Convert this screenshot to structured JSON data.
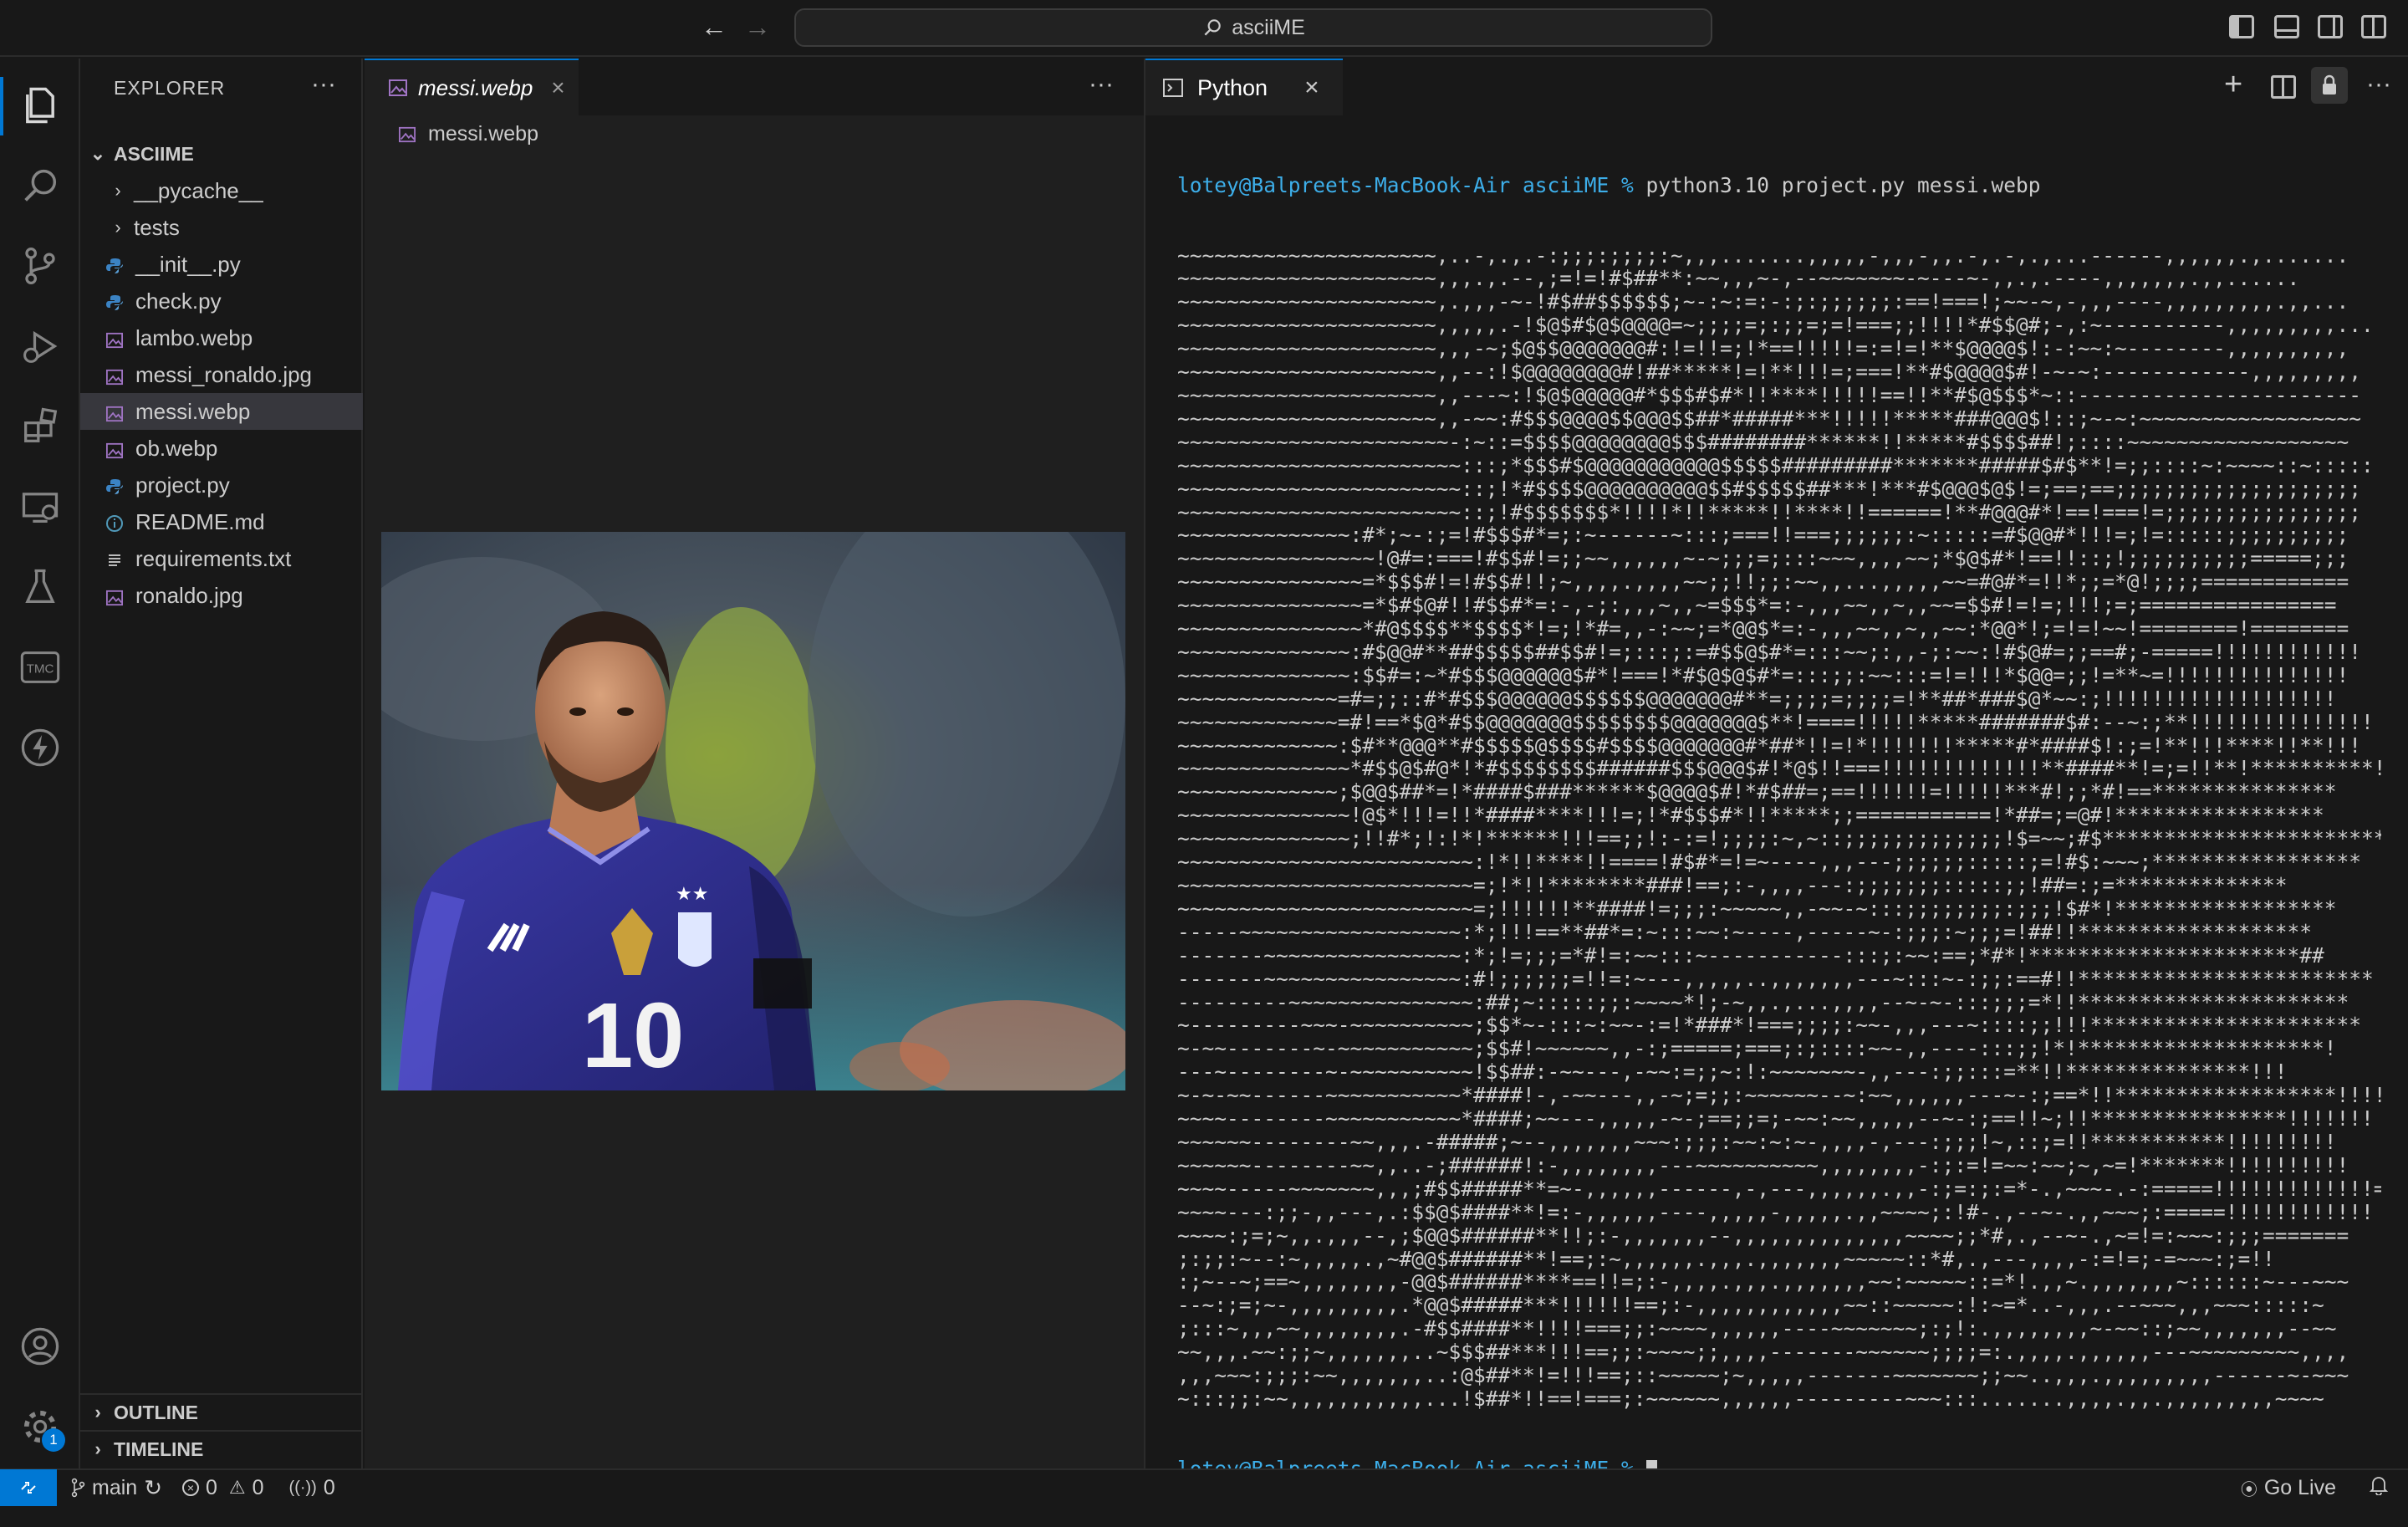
{
  "window": {
    "search_text": "asciiME"
  },
  "colors": {
    "accent": "#0078d4",
    "prompt": "#3daee9",
    "selection": "#37373d",
    "background": "#181818"
  },
  "sidebar": {
    "title": "EXPLORER",
    "more": "···",
    "root": "ASCIIME",
    "items": [
      {
        "label": "__pycache__",
        "kind": "folder"
      },
      {
        "label": "tests",
        "kind": "folder"
      },
      {
        "label": "__init__.py",
        "kind": "python"
      },
      {
        "label": "check.py",
        "kind": "python"
      },
      {
        "label": "lambo.webp",
        "kind": "image"
      },
      {
        "label": "messi_ronaldo.jpg",
        "kind": "image"
      },
      {
        "label": "messi.webp",
        "kind": "image",
        "selected": true
      },
      {
        "label": "ob.webp",
        "kind": "image"
      },
      {
        "label": "project.py",
        "kind": "python"
      },
      {
        "label": "README.md",
        "kind": "info"
      },
      {
        "label": "requirements.txt",
        "kind": "text"
      },
      {
        "label": "ronaldo.jpg",
        "kind": "image"
      }
    ],
    "outline": "OUTLINE",
    "timeline": "TIMELINE"
  },
  "editor": {
    "tab_label": "messi.webp",
    "breadcrumb": "messi.webp",
    "more": "···",
    "jersey_number": "10"
  },
  "terminal": {
    "tab_label": "Python",
    "prompt": "lotey@Balpreets-MacBook-Air asciiME % ",
    "command": "python3.10 project.py messi.webp",
    "ascii_lines": [
      "~~~~~~~~~~~~~~~~~~~~~,..-,.,.-:;;;:;;;;:~,,,.......,,,,,-,,,-,,.-,.-,.,...------,,,,,,.,.......",
      "~~~~~~~~~~~~~~~~~~~~~,,,.,.--,;=!=!#$##**:~~,,,~-,--~~~~~~~-~---~-,,.,.----,,,,,,,.,,......",
      "~~~~~~~~~~~~~~~~~~~~~,.,,,-~-!#$##$$$$$$;~-:~:=:-:;:;;;;;;:==!===!;~~-~,-,,,----,,,,,,,,,.,,...",
      "~~~~~~~~~~~~~~~~~~~~~,,,,,.-!$@$#$@$@@@@=~;;;;=;:;;=;=!===;;!!!!*#$$@#;-,:~----------,,,,,,,,,...",
      "~~~~~~~~~~~~~~~~~~~~~,,,-~;$@$$@@@@@@@#:!=!!=;!*==!!!!!=:=!=!**$@@@@$!:-:~~:~--------,,,,,,,,,,",
      "~~~~~~~~~~~~~~~~~~~~~,,--:!$@@@@@@@@#!##*****!=!**!!!=;===!**#$@@@@$#!-~-~:------------,,,,,,,,,",
      "~~~~~~~~~~~~~~~~~~~~~,,---~:!$@$@@@@@#*$$$#$#*!!****!!!!!==!!**#$@$$$*~::-----------------------",
      "~~~~~~~~~~~~~~~~~~~~~,,-~~:#$$$@@@@$$@@@$$##*#####***!!!!!*****###@@@$!::;~-~:~~~~~~~~~~~~~~~~~~",
      "~~~~~~~~~~~~~~~~~~~~~~-:~::=$$$$@@@@@@@@$$$########******!!*****#$$$$##!;::::~~~~~~~~~~~~~~~~~~",
      "~~~~~~~~~~~~~~~~~~~~~~~:::;*$$$#$@@@@@@@@@@@$$$$$#########*******#####$#$**!=;;::::~:~~~~::~:::::",
      "~~~~~~~~~~~~~~~~~~~~~~~::;!*#$$$$@@@@@@@@@@$$#$$$$$##***!***#$@@@$@$!=;==;==;;;;;;;;;;;;;;;;;;;;",
      "~~~~~~~~~~~~~~~~~~~~~~~::;!#$$$$$$$*!!!!*!!*****!!****!!======!**#@@@#*!==!===!=;;;;;;;;;;;;;;;;",
      "~~~~~~~~~~~~~~:#*;~-:;=!#$$$#*=;:~------~:::;===!!===;;;;;;:~:::::=#$@@#*!!!=;!=:::::;;;;;;;;;;",
      "~~~~~~~~~~~~~~~~!@#=:===!#$$#!=;;~~,,,,,,~-~;;;=;:::~~~,,,,~~;*$@$#*!==!!::;!;;;;;;;;;;=====;;;",
      "~~~~~~~~~~~~~~~=*$$$#!=!#$$#!!;~,,,,.,,,,~~;;!!;;:~~,,...,,,,,~~=#@#*=!!*;;=*@!;;;;============",
      "~~~~~~~~~~~~~~~=*$#$@#!!#$$#*=:-,-;:,,,~,,~=$$$*=:-,,,~~,,~,,~~=$$#!=!=;!!!;=;================",
      "~~~~~~~~~~~~~~~*#@$$$$**$$$$*!=;!*#=,,-:~~;=*@@$*=:-,,,~~,,~,,~~:*@@*!;=!=!~~!========!========",
      "~~~~~~~~~~~~~~:#$@@#**##$$$$$##$$#!=;:::;:=#$$@$#*=:::~~;:,,-;:~~:!#$@#=;;==#;-=====!!!!!!!!!!!!",
      "~~~~~~~~~~~~~~:$$#=:~*#$$$@@@@@@$#*!===!*#$@$@$#*=:::;;:~~:::=!=!!!*$@@=;;!=**~=!!!!!!!!!!!!!!!",
      "~~~~~~~~~~~~~=#=;;::#*#$$$@@@@@@$$$$$$@@@@@@@#**=;;;;=;;;;=!**##*###$@*~~:;!!!!!!!!!!!!!!!!!!!",
      "~~~~~~~~~~~~~=#!==*$@*#$$@@@@@@@$$$$$$$$@@@@@@@$**!====!!!!!*****#######$#:--~:;**!!!!!!!!!!!!!!!",
      "~~~~~~~~~~~~~:$#**@@@**#$$$$$@$$$$#$$$$@@@@@@@#*##*!!=!*!!!!!!!*****#*####$!:;=!**!!!****!!**!!!",
      "~~~~~~~~~~~~~~*#$$@$#@*!*#$$$$$$$$######$$$@@@$#!*@$!!===!!!!!!!!!!!!!**####**!=;=!!**!**********!",
      "~~~~~~~~~~~~~;$@@$##*=!*####$###******$@@@@$#!*#$##=;==!!!!!!=!!!!!***#!;;*#!==***************",
      "~~~~~~~~~~~~~~!@$*!!!=!!*####****!!!=;!*#$$$#*!!*****;;===========!*##=;=@#!*****************",
      "~~~~~~~~~~~~~~;!!#*;!:!*!******!!!==;;!:-:=!;;;;:~,~::;;;;;;;;;;;;;!$=~~;#$***********************",
      "~~~~~~~~~~~~~~~~~~~~~~~~:!*!!****!!====!#$#*=!=~----,,,---;;;;;;:::::;=!#$:~~~;*****************",
      "~~~~~~~~~~~~~~~~~~~~~~~~=;!*!!********###!==;:-,,,,---:;;;;;;;:::::;;!##=:;=**************",
      "~~~~~~~~~~~~~~~~~~~~~~~~=;!!!!!!**####!=;;;:~~~~~,,-~~-~:::;;;;;;;;:;;;!$#*!******************",
      "-----~~~~~~~~~~~~~~~~~~:*;!!!==**##*=:~:::~~:~----,-----~-:;;;:~;;;=!##!!*******************",
      "-------~~~~~~~~~~~~~~~~:*;!=;;;=*#!=:~~:::~-----------:::;:~~:==;*#*!**********************##",
      "-------~~~~~~~~~~~~~~~~:#!;;;;;;=!!=:~---,,,,,..,,,,,,,---~:::~-:;;:==#!!************************",
      "---------~~~~~~~~~~~~~~~:##;~:::::;;:~~~~*!;-~,,.,...,,,,--~-~-:::;;;=*!!**********************",
      "~---------~~~-~~~~~~~~~~;$$*~-:::~:~~-:=!*###*!===;;;;:~~-,,,---~::::;;!!!**********************",
      "~-~~-------~-~~~~~~~~~~~;$$#!~~~~~~,,-:;=====;===;:;::::~~-,,----:::;;!*!********************!",
      "---~--------~-~~~~~~~~~~!$$##:-~~---,-~~:=;;~:!:~~~~~~~-,,---:;;:::=**!!***************!!!",
      "~-~-~~------~~~~~~~~~~~*####!-,-~~---,,-~;=;;:~~~~~~--~:~~,,,,,,---~-:;==*!!******************!!!!",
      "~~~~--------~~~~~~~~~~~*####;~~---,,,,,-~-;==;;=;-~~:~~,,,,,--~-:;==!!~;!!****************!!!!!!!",
      "~~~~~~--------~~,,,.-#####;~--,,,,,,,~~~:;;;:~~:~:~-,,,,-,---:;;;!~,::;=!!***********!!!!!!!!!",
      "~~~~~~--------~~,,..-;######!:-,,,,,,,,---~~~~~~~~~~,,,,,,,,-:;:=!=~~:~~;~,~=!*******!!!!!!!!!!",
      "~~~~-----~~~~~~~,,,;#$$#####**=~-,,,,,,------,-,---,,,,,,.,,-:;=:;:=*-.,~~~-.-:=====!!!!!!!!!!!!!=",
      "~~~~---:;;-,,---,.:$$@$####**!=:-,,,,,,----,,,,,-,,,,,.,,~~~~;:!#-.,--~-.,,~~~;:=====!!!!!!!!!!!!",
      "~~~~:;=;~,,.,,,--,;$@@$######**!!;:-,,,,,,,--,,,,,,,,,,,,,,~~~~;;*#,.,--~-.,~=!=:~~~:;;;=======",
      ";:;;:~--:~,,,,,.,~#@@$######**!==;:~,,,,,,.,,,.,,,,,,,~~~~~::*#,.,---,,,,-:=!=;-=~~~:;=!!",
      ":;~--~;==~,,,,,,,,-@@$######****==!!=;:-,,,,.,,,.,,,,,,,~~:~~~~~::=*!.,,~.,,,,,,,~::::::~---~~~",
      "--~:;=;~-,,,,,,,,,.*@@$#####***!!!!!!==;:-,,,,,,,,,,,,~~::~~~~~:!:~=*..-,,,.--~~~,,,~~~:::::~",
      ";:::~,,,~~,,,,,,,,.-#$$####**!!!!===;;:~~~~,,,,,,----~~~~~~~;:;!:.,,,,,,,,~-~~::;~~,,,,,,,--~~",
      "~~,,,.~~:;;~,,,,,,,..~$$$##***!!!==;;:~~~~;;,,,,-------~~~~~~;;;;=:.,,,,.,,,,,,---~~~~~~~~~,,,,",
      ",,,~~~:;;;:~~,,,,,,,..:@$##**!=!!!==;::~~~~~;~,,,,,-------~~~~~~~;;~~..,,,.,,,,,,,,,------~-~~~",
      "~:::;;:~~,,,,,,,,,,,...!$##*!!==!===;:~~~~~~,,,,,,---------~~~:::.......,,,,.,,.,,,,,,,,,~~~~"
    ]
  },
  "statusbar": {
    "branch": "main",
    "errors": "0",
    "warnings": "0",
    "ports": "0",
    "golive": "Go Live",
    "settings_badge": "1"
  }
}
